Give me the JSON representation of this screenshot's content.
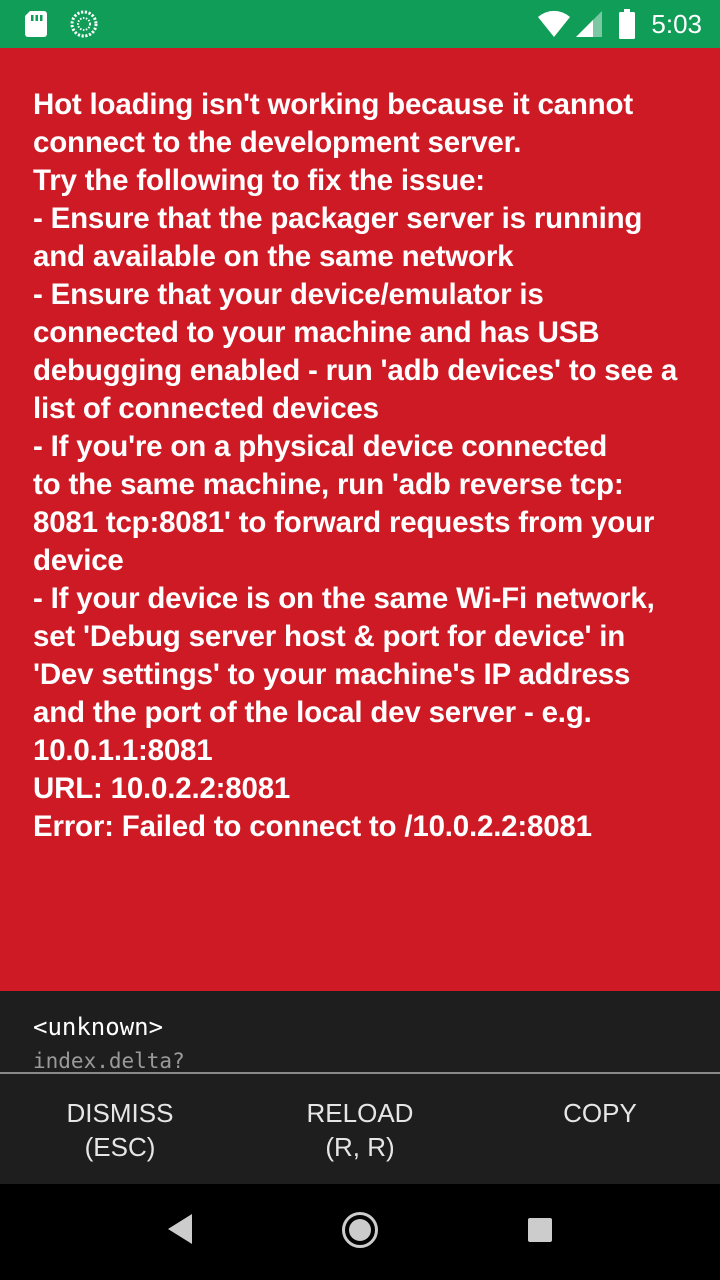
{
  "status_bar": {
    "time": "5:03",
    "icons": [
      "sd-card-icon",
      "sync-spinner-icon",
      "wifi-icon",
      "cell-signal-icon",
      "battery-icon"
    ],
    "background_color": "#0f9d58"
  },
  "error": {
    "background_color": "#ce1a25",
    "lines": [
      "Hot loading isn't working because it cannot",
      "connect to the development server.",
      "",
      "Try the following to fix the issue:",
      "- Ensure that the packager server is running",
      "and available on the same network",
      "- Ensure that your device/emulator is",
      "connected to your machine and has USB",
      "debugging enabled - run 'adb devices' to see a",
      "list of connected devices",
      "- If you're on a physical device connected",
      "to the same machine, run 'adb reverse tcp:",
      "8081 tcp:8081' to forward requests from your",
      "device",
      "- If your device is on the same Wi-Fi network,",
      "set 'Debug server host & port for device' in",
      "'Dev settings' to your machine's IP address",
      "and the port of the local dev server - e.g.",
      "10.0.1.1:8081",
      "",
      "URL: 10.0.2.2:8081",
      "",
      "Error: Failed to connect to /10.0.2.2:8081"
    ]
  },
  "stack": {
    "method": "<unknown>",
    "file": "index.delta?"
  },
  "buttons": {
    "dismiss": {
      "line1": "DISMISS",
      "line2": "(ESC)"
    },
    "reload": {
      "line1": "RELOAD",
      "line2": "(R, R)"
    },
    "copy": {
      "line1": "COPY",
      "line2": ""
    }
  },
  "nav_bar": {
    "icons": [
      "back-icon",
      "home-icon",
      "recent-apps-icon"
    ]
  }
}
